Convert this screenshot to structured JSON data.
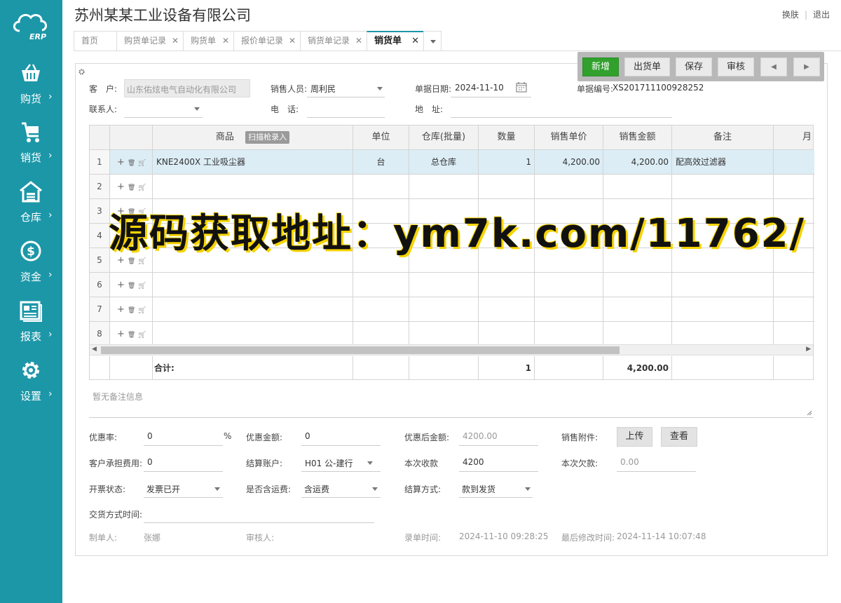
{
  "sidebar": {
    "logo_text": "ERP",
    "items": [
      {
        "label": "购货",
        "icon": "basket-icon"
      },
      {
        "label": "销货",
        "icon": "cart-icon"
      },
      {
        "label": "仓库",
        "icon": "warehouse-icon"
      },
      {
        "label": "资金",
        "icon": "dollar-icon"
      },
      {
        "label": "报表",
        "icon": "report-icon"
      },
      {
        "label": "设置",
        "icon": "gear-icon"
      }
    ],
    "arrow": "›"
  },
  "header": {
    "company": "苏州某某工业设备有限公司",
    "skin": "换肤",
    "sep": "|",
    "logout": "退出"
  },
  "tabs": [
    {
      "label": "首页",
      "closable": false
    },
    {
      "label": "购货单记录",
      "closable": true
    },
    {
      "label": "购货单",
      "closable": true
    },
    {
      "label": "报价单记录",
      "closable": true
    },
    {
      "label": "销货单记录",
      "closable": true
    },
    {
      "label": "销货单",
      "closable": true,
      "active": true
    }
  ],
  "toolbar": {
    "new": "新增",
    "ship": "出货单",
    "save": "保存",
    "audit": "审核",
    "prev": "◀",
    "next": "▶"
  },
  "form": {
    "customer_label": "客　户:",
    "customer_value": "山东佑炫电气自动化有限公司",
    "sales_label": "销售人员:",
    "sales_value": "周利民",
    "date_label": "单据日期:",
    "date_value": "2024-11-10",
    "docno_label": "单据编号:",
    "docno_value": "XS201711100928252",
    "contact_label": "联系人:",
    "phone_label": "电　话:",
    "address_label": "地　址:"
  },
  "grid": {
    "headers": [
      "商品",
      "单位",
      "仓库(批量)",
      "数量",
      "销售单价",
      "销售金额",
      "备注",
      "月"
    ],
    "scan_label": "扫描枪录入",
    "rows": [
      {
        "no": "1",
        "product": "KNE2400X 工业吸尘器",
        "unit": "台",
        "warehouse": "总仓库",
        "qty": "1",
        "price": "4,200.00",
        "amount": "4,200.00",
        "note": "配高效过滤器"
      },
      {
        "no": "2",
        "product": "",
        "unit": "",
        "warehouse": "",
        "qty": "",
        "price": "",
        "amount": "",
        "note": ""
      },
      {
        "no": "3",
        "product": "",
        "unit": "",
        "warehouse": "",
        "qty": "",
        "price": "",
        "amount": "",
        "note": ""
      },
      {
        "no": "4",
        "product": "",
        "unit": "",
        "warehouse": "",
        "qty": "",
        "price": "",
        "amount": "",
        "note": ""
      },
      {
        "no": "5",
        "product": "",
        "unit": "",
        "warehouse": "",
        "qty": "",
        "price": "",
        "amount": "",
        "note": ""
      },
      {
        "no": "6",
        "product": "",
        "unit": "",
        "warehouse": "",
        "qty": "",
        "price": "",
        "amount": "",
        "note": ""
      },
      {
        "no": "7",
        "product": "",
        "unit": "",
        "warehouse": "",
        "qty": "",
        "price": "",
        "amount": "",
        "note": ""
      },
      {
        "no": "8",
        "product": "",
        "unit": "",
        "warehouse": "",
        "qty": "",
        "price": "",
        "amount": "",
        "note": ""
      }
    ],
    "total_label": "合计:",
    "total_qty": "1",
    "total_amount": "4,200.00"
  },
  "remark_placeholder": "暂无备注信息",
  "footer": {
    "discount_rate_label": "优惠率:",
    "discount_rate_value": "0",
    "percent": "%",
    "discount_amount_label": "优惠金额:",
    "discount_amount_value": "0",
    "after_discount_label": "优惠后金额:",
    "after_discount_value": "4200.00",
    "attach_label": "销售附件:",
    "upload": "上传",
    "view": "查看",
    "customer_fee_label": "客户承担费用:",
    "customer_fee_value": "0",
    "account_label": "结算账户:",
    "account_value": "H01 公-建行",
    "received_label": "本次收款",
    "received_value": "4200",
    "owed_label": "本次欠款:",
    "owed_value": "0.00",
    "invoice_label": "开票状态:",
    "invoice_value": "发票已开",
    "freight_label": "是否含运费:",
    "freight_value": "含运费",
    "settle_label": "结算方式:",
    "settle_value": "款到发货",
    "delivery_label": "交货方式时间:",
    "maker_label": "制单人:",
    "maker_value": "张娜",
    "auditor_label": "审核人:",
    "record_time_label": "录单时间:",
    "record_time_value": "2024-11-10 09:28:25",
    "modified_label": "最后修改时间:",
    "modified_value": "2024-11-14 10:07:48"
  },
  "watermark": "源码获取地址：ym7k.com/11762/"
}
